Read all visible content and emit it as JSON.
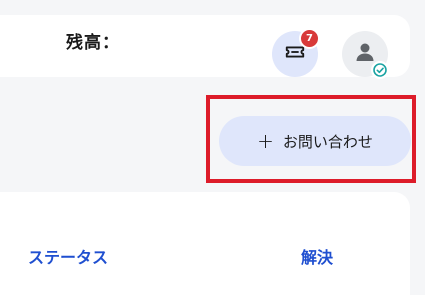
{
  "header": {
    "balance_label": "残高：",
    "ticket_badge_count": "7",
    "icons": {
      "ticket": "ticket-icon",
      "avatar": "user-icon",
      "verified": "check-circle-icon"
    }
  },
  "actions": {
    "plus_glyph": "+",
    "inquiry_label": "お問い合わせ"
  },
  "table": {
    "headers": [
      "ステータス",
      "解決"
    ]
  },
  "colors": {
    "accent": "#1f4fd0",
    "button_bg": "#dfe6fb",
    "badge": "#d83a3a",
    "highlight": "#dd1c2a",
    "verified": "#1aa3a3"
  }
}
